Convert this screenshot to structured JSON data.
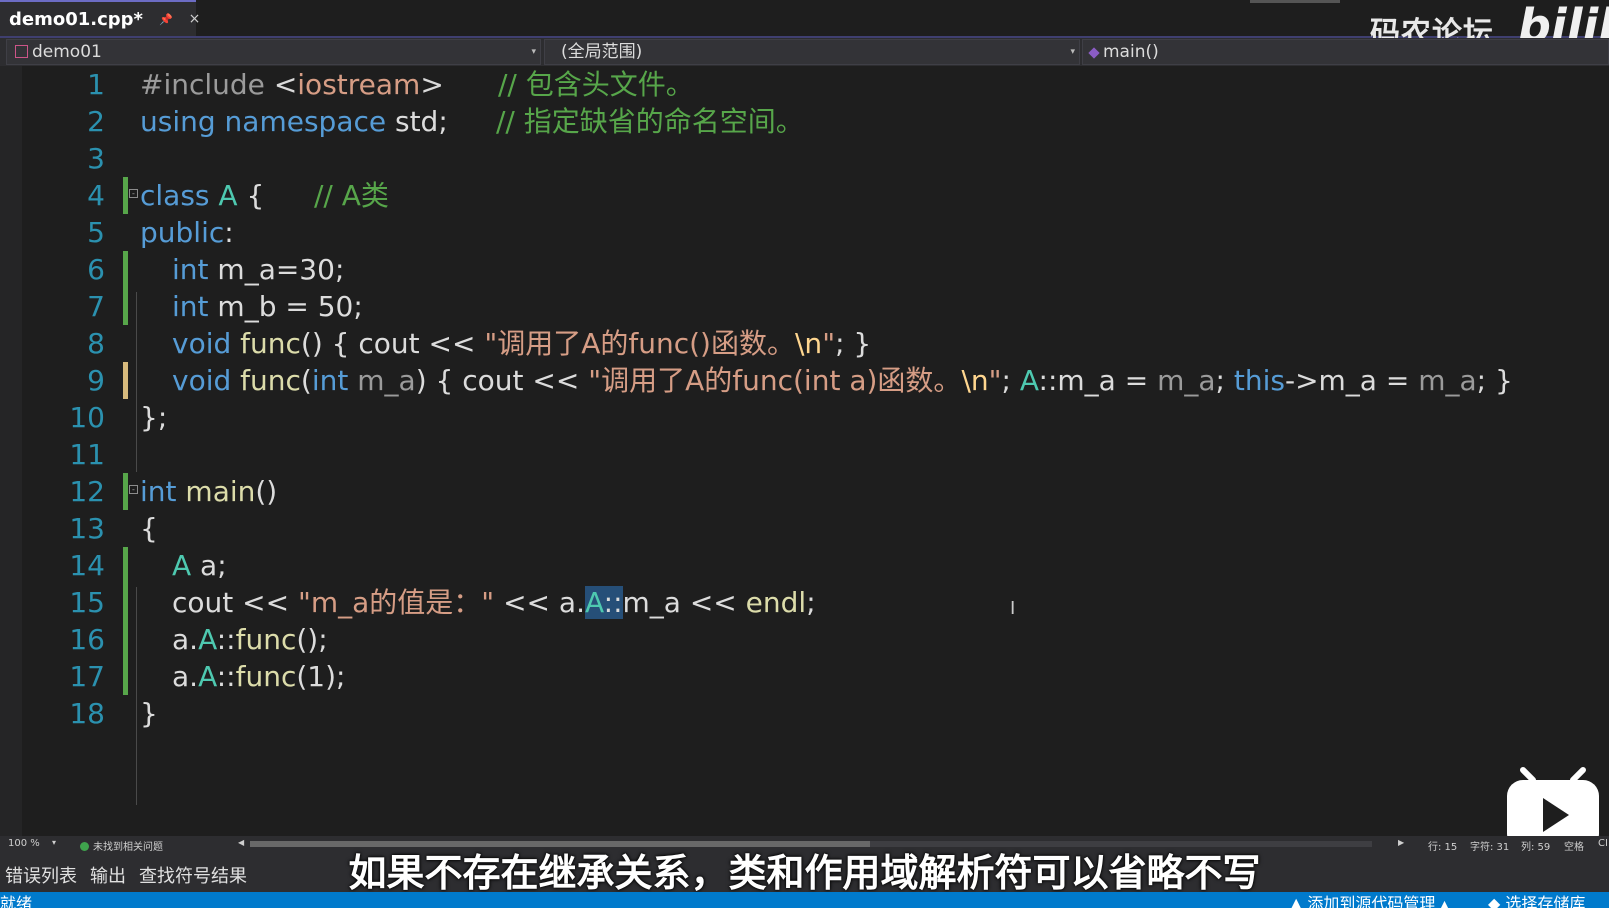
{
  "tab": {
    "title": "demo01.cpp*",
    "pin": "•",
    "close": "×"
  },
  "watermark": {
    "text": "码农论坛",
    "logo": "bilib"
  },
  "navbar": {
    "project": "demo01",
    "scope": "(全局范围)",
    "member": "main()"
  },
  "editor": {
    "line_numbers": [
      "1",
      "2",
      "3",
      "4",
      "5",
      "6",
      "7",
      "8",
      "9",
      "10",
      "11",
      "12",
      "13",
      "14",
      "15",
      "16",
      "17",
      "18"
    ],
    "l1": {
      "pp": "#include ",
      "hdr_open": "<",
      "hdr": "iostream",
      "hdr_close": ">",
      "comment": "// 包含头文件。"
    },
    "l2": {
      "kw1": "using",
      "kw2": "namespace",
      "rest": " std;",
      "comment": "// 指定缺省的命名空间。"
    },
    "l4": {
      "kw": "class",
      "type": "A",
      "brace": " {",
      "comment": "// A类"
    },
    "l5": {
      "kw": "public",
      "colon": ":"
    },
    "l6": {
      "kw": "int",
      "rest": " m_a=30;"
    },
    "l7": {
      "kw": "int",
      "rest": " m_b = 50;"
    },
    "l8": {
      "kw": "void",
      "fn": "func",
      "p1": "() { cout << ",
      "str": "\"调用了A的func()函数。",
      "esc": "\\n",
      "str2": "\"",
      "p2": "; }"
    },
    "l9": {
      "kw": "void",
      "fn": "func",
      "p1": "(",
      "kw2": "int",
      "param": " m_a",
      "p2": ") { cout << ",
      "str": "\"调用了A的func(int a)函数。",
      "esc": "\\n",
      "str2": "\"",
      "p3": "; ",
      "ty": "A",
      "p4": "::m_a = ",
      "param2": "m_a",
      "p5": "; ",
      "kw3": "this",
      "p6": "->m_a = ",
      "param3": "m_a",
      "p7": "; }"
    },
    "l10": {
      "text": "};"
    },
    "l12": {
      "kw": "int",
      "fn": " main",
      "rest": "()"
    },
    "l13": {
      "text": "{"
    },
    "l14": {
      "ty": "A",
      "rest": " a;"
    },
    "l15": {
      "p1": "cout << ",
      "str": "\"m_a的值是：\"",
      "p2": " << a.",
      "ty": "A",
      "p3": "::",
      "p4": "m_a << ",
      "fn": "endl",
      "p5": ";"
    },
    "l16": {
      "p1": "a.",
      "ty": "A",
      "p2": "::",
      "fn": "func",
      "p3": "();"
    },
    "l17": {
      "p1": "a.",
      "ty": "A",
      "p2": "::",
      "fn": "func",
      "p3": "(1);"
    },
    "l18": {
      "text": "}"
    }
  },
  "caret": "I",
  "statusstrip": {
    "zoom": "100 %",
    "issues": "未找到相关问题",
    "line": "行: 15",
    "char": "字符: 31",
    "col": "列: 59",
    "ws": "空格",
    "enc": "CI"
  },
  "panel_tabs": [
    "错误列表",
    "输出",
    "查找符号结果"
  ],
  "subtitle": "如果不存在继承关系，类和作用域解析符可以省略不写",
  "statusbar": {
    "ready": "就绪",
    "add_source": "▲ 添加到源代码管理 ▴",
    "repo": "◆ 选择存储库"
  }
}
